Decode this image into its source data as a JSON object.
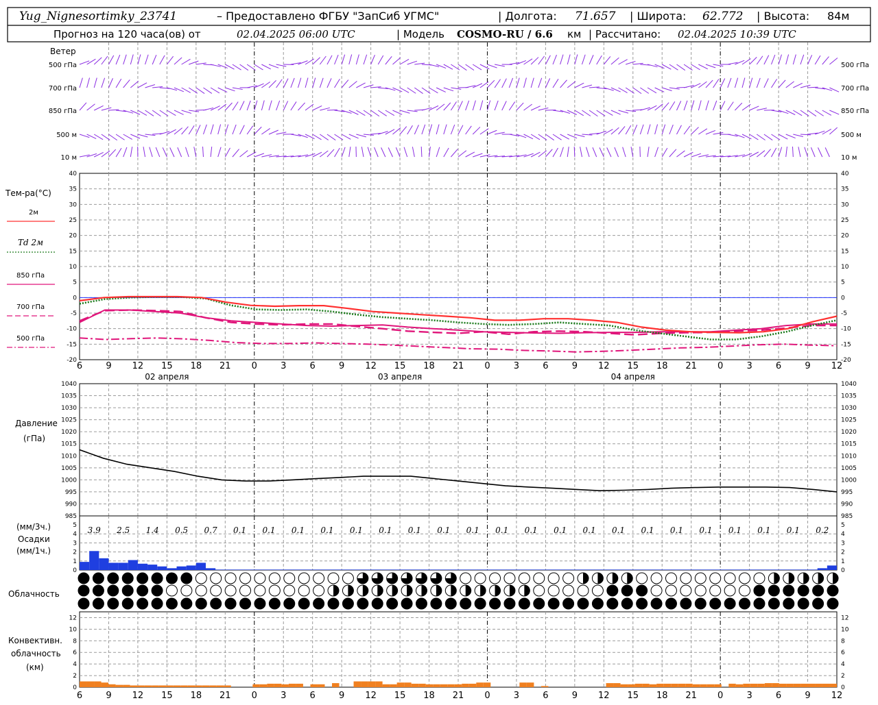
{
  "header": {
    "station": "Yug_Nignesortimky_23741",
    "provider": "– Предоставлено ФГБУ \"ЗапСиб УГМС\"",
    "lon_label": "| Долгота:",
    "lon": "71.657",
    "lat_label": "| Широта:",
    "lat": "62.772",
    "alt_label": "| Высота:",
    "alt": "84м",
    "forecast_label": "Прогноз на 120 часа(ов)  от",
    "forecast_start": "02.04.2025 06:00 UTC",
    "model_label": "| Модель",
    "model": "COSMO-RU / 6.6",
    "model_unit": "км",
    "calc_label": "| Рассчитано:",
    "calc_time": "02.04.2025 10:39 UTC"
  },
  "wind_panel": {
    "title": "Ветер",
    "levels": [
      "500 гПа",
      "700 гПа",
      "850 гПа",
      "500 м",
      "10  м"
    ],
    "color": "#8a2be2"
  },
  "temp_panel": {
    "title": "Тем-ра(°C)",
    "legend": [
      {
        "label": "2м",
        "color": "#ff3030",
        "style": "solid"
      },
      {
        "label": "Td  2м",
        "color": "#1a7a1a",
        "style": "dotted"
      },
      {
        "label": "850 гПа",
        "color": "#e0157a",
        "style": "solid"
      },
      {
        "label": "700 гПа",
        "color": "#e0157a",
        "style": "dashed"
      },
      {
        "label": "500 гПа",
        "color": "#e0157a",
        "style": "dashdot"
      }
    ],
    "yticks": [
      "40",
      "35",
      "30",
      "25",
      "20",
      "15",
      "10",
      "5",
      "0",
      "-5",
      "-10",
      "-15",
      "-20"
    ]
  },
  "x_axis": {
    "hour_labels": [
      "6",
      "9",
      "12",
      "15",
      "18",
      "21",
      "0",
      "3",
      "6",
      "9",
      "12",
      "15",
      "18",
      "21",
      "0",
      "3",
      "6",
      "9",
      "12",
      "15",
      "18",
      "21",
      "0",
      "3",
      "6",
      "9",
      "12"
    ],
    "day_labels": [
      "02 апреля",
      "03 апреля",
      "04 апреля"
    ]
  },
  "pressure_panel": {
    "title": "Давление",
    "unit": "(гПа)",
    "yticks": [
      "1040",
      "1035",
      "1030",
      "1025",
      "1020",
      "1015",
      "1010",
      "1005",
      "1000",
      "995",
      "990",
      "985"
    ]
  },
  "precip_panel": {
    "unit3": "(мм/3ч.)",
    "title": "Осадки",
    "unit1": "(мм/1ч.)",
    "yticks": [
      "5",
      "4",
      "3",
      "2",
      "1",
      "0"
    ],
    "totals_3h": [
      "3.9",
      "2.5",
      "1.4",
      "0.5",
      "0.7",
      "0.1",
      "0.1",
      "0.1",
      "0.1",
      "0.1",
      "0.1",
      "0.1",
      "0.1",
      "0.1",
      "0.1",
      "0.1",
      "0.1",
      "0.1",
      "0.1",
      "0.1",
      "0.1",
      "0.1",
      "0.1",
      "0.1",
      "0.1",
      "0.2"
    ],
    "color": "#1f3fe0"
  },
  "cloud_panel": {
    "title": "Облачность"
  },
  "conv_panel": {
    "title1": "Конвективн.",
    "title2": "облачность",
    "unit": "(км)",
    "yticks": [
      "12",
      "10",
      "8",
      "6",
      "4",
      "2",
      "0"
    ],
    "color": "#f08020"
  },
  "chart_data": [
    {
      "type": "line",
      "title": "Тем-ра(°C)",
      "ylim": [
        -20,
        40
      ],
      "x_hours": [
        0,
        3,
        6,
        9,
        12,
        15,
        18,
        21,
        24,
        27,
        30,
        33,
        36,
        39,
        42,
        45,
        48,
        51,
        54,
        57,
        60,
        63,
        66,
        69,
        72,
        75,
        78
      ],
      "series": [
        {
          "name": "2м",
          "values": [
            -1,
            0,
            0.3,
            0.3,
            0.3,
            0,
            -1.5,
            -2.5,
            -2.8,
            -2.6,
            -2.6,
            -3.5,
            -4.5,
            -5,
            -5.5,
            -6,
            -6.5,
            -7.3,
            -7.3,
            -6.8,
            -6.8,
            -7.3,
            -8,
            -9.5,
            -10.5,
            -11,
            -11.2,
            -11.3,
            -11,
            -10,
            -7.8,
            -6
          ]
        },
        {
          "name": "Td  2м",
          "values": [
            -2,
            -0.5,
            0,
            0.2,
            0.2,
            -0.3,
            -2.5,
            -3.8,
            -4,
            -3.8,
            -4.5,
            -5.5,
            -6.3,
            -6.8,
            -7.3,
            -8,
            -8.5,
            -8.8,
            -8.5,
            -8,
            -8.5,
            -9,
            -10.5,
            -11.5,
            -12.5,
            -13.5,
            -13.5,
            -12.5,
            -11,
            -9,
            -7.3
          ]
        },
        {
          "name": "850 гПа",
          "values": [
            -8,
            -4,
            -4,
            -4.5,
            -5,
            -6.5,
            -7.5,
            -8,
            -8.5,
            -9,
            -9.2,
            -9,
            -8.8,
            -9.5,
            -10,
            -10.5,
            -11,
            -11.2,
            -11.4,
            -11.5,
            -11.3,
            -11.2,
            -11.2,
            -11,
            -11,
            -11,
            -10.5,
            -10,
            -9,
            -8.5,
            -8.5
          ]
        },
        {
          "name": "700 гПа",
          "values": [
            -7.5,
            -4.2,
            -4,
            -4.2,
            -4.5,
            -6.5,
            -8,
            -8.5,
            -8.8,
            -8.5,
            -8.5,
            -9.3,
            -10,
            -10.8,
            -11.2,
            -11.5,
            -11,
            -11.8,
            -11,
            -10.8,
            -11,
            -11.5,
            -12,
            -11.5,
            -11.3,
            -11.2,
            -10.8,
            -10.5,
            -9.8,
            -9,
            -9
          ]
        },
        {
          "name": "500 гПа",
          "values": [
            -13,
            -13.5,
            -13.2,
            -13,
            -13.3,
            -13.8,
            -14.5,
            -14.8,
            -14.8,
            -14.6,
            -14.8,
            -15,
            -15.3,
            -15.7,
            -16.1,
            -16.5,
            -16.6,
            -17,
            -17.2,
            -17.5,
            -17.3,
            -17,
            -16.6,
            -16.2,
            -16,
            -15.6,
            -15.2,
            -15,
            -15.3,
            -15.5
          ]
        }
      ]
    },
    {
      "type": "line",
      "title": "Давление",
      "ylabel": "(гПа)",
      "ylim": [
        985,
        1040
      ],
      "series": [
        {
          "name": "",
          "values": [
            1012.5,
            1009,
            1006.5,
            1005,
            1003.5,
            1001.5,
            1000,
            999.5,
            999.5,
            1000,
            1000.5,
            1001,
            1001.5,
            1001.5,
            1001.5,
            1000.5,
            999.5,
            998.5,
            997.5,
            997,
            996.5,
            996,
            995.5,
            995.7,
            996,
            996.5,
            996.8,
            997,
            997,
            997,
            996.8,
            996,
            995
          ]
        }
      ]
    },
    {
      "type": "bar",
      "title": "Осадки",
      "ylim": [
        0,
        5
      ],
      "values_1h": [
        0.9,
        2.1,
        1.3,
        0.8,
        0.8,
        1.1,
        0.7,
        0.6,
        0.4,
        0.2,
        0.4,
        0.5,
        0.8,
        0.2,
        0.05,
        0.05,
        0.05,
        0.05,
        0.05,
        0.05,
        0.05,
        0.05,
        0.05,
        0.05,
        0.05,
        0.05,
        0.05,
        0.05,
        0.05,
        0.05,
        0.05,
        0.05,
        0.05,
        0.05,
        0.05,
        0.05,
        0.05,
        0.05,
        0.05,
        0.05,
        0.05,
        0.05,
        0.05,
        0.05,
        0.05,
        0.05,
        0.05,
        0.05,
        0.05,
        0.05,
        0.05,
        0.05,
        0.05,
        0.05,
        0.05,
        0.05,
        0.05,
        0.05,
        0.05,
        0.05,
        0.05,
        0.05,
        0.05,
        0.05,
        0.05,
        0.05,
        0.05,
        0.05,
        0.05,
        0.05,
        0.05,
        0.05,
        0.05,
        0.05,
        0.05,
        0.05,
        0.2,
        0.5
      ]
    },
    {
      "type": "bar",
      "title": "Конвективн. облачность",
      "ylim": [
        0,
        13
      ],
      "values": [
        1.0,
        1.0,
        1.0,
        0.8,
        0.5,
        0.4,
        0.4,
        0.3,
        0.3,
        0.3,
        0.3,
        0.3,
        0.3,
        0.3,
        0.3,
        0.3,
        0.3,
        0.3,
        0.3,
        0.3,
        0.3,
        0.0,
        0.0,
        0.0,
        0.5,
        0.5,
        0.6,
        0.6,
        0.5,
        0.6,
        0.6,
        0.0,
        0.5,
        0.5,
        0.0,
        0.7,
        0.0,
        0.0,
        1.0,
        1.0,
        1.0,
        1.0,
        0.5,
        0.5,
        0.8,
        0.8,
        0.6,
        0.6,
        0.5,
        0.5,
        0.5,
        0.5,
        0.5,
        0.6,
        0.6,
        0.8,
        0.8,
        0.0,
        0.0,
        0.0,
        0.0,
        0.8,
        0.8,
        0.0,
        0.2,
        0.0,
        0.0,
        0.0,
        0.0,
        0.0,
        0.0,
        0.0,
        0.0,
        0.7,
        0.7,
        0.5,
        0.5,
        0.6,
        0.6,
        0.5,
        0.6,
        0.6,
        0.6,
        0.6,
        0.6,
        0.5,
        0.5,
        0.5,
        0.5,
        0.0,
        0.6,
        0.5,
        0.6,
        0.6,
        0.6,
        0.7,
        0.7,
        0.6,
        0.6,
        0.6,
        0.6,
        0.6,
        0.6,
        0.6,
        0.6
      ]
    }
  ]
}
